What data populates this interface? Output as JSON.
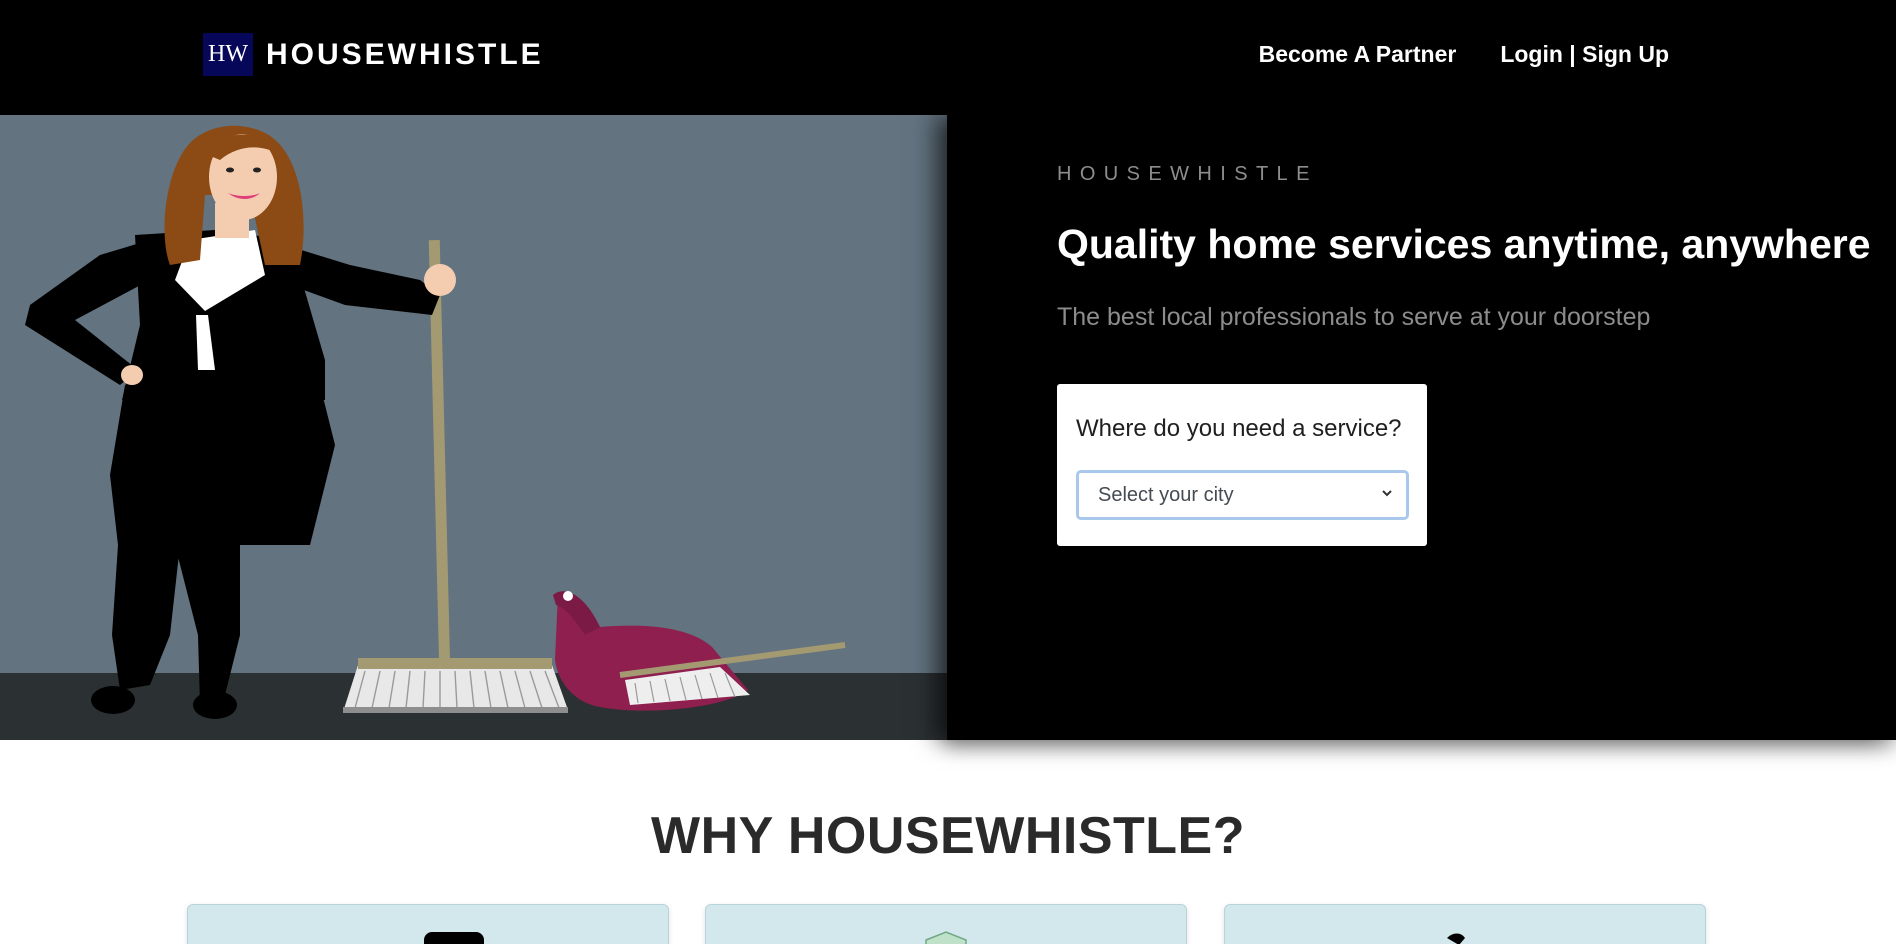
{
  "brand": {
    "logo_text": "HW",
    "name": "HOUSEWHISTLE"
  },
  "nav": {
    "partner": "Become A Partner",
    "login": "Login | Sign Up"
  },
  "hero": {
    "eyebrow": "HOUSEWHISTLE",
    "headline": "Quality home services anytime, anywhere",
    "subline": "The best local professionals to serve at your doorstep",
    "service_question": "Where do you need a service?",
    "city_select_value": "Select your city"
  },
  "why": {
    "title": "WHY HOUSEWHISTLE?"
  },
  "colors": {
    "topbar": "#000000",
    "logo_bg": "#07075a",
    "hero_wall": "#637380",
    "hero_floor": "#2b3033",
    "feature_card": "#d3e8ed"
  },
  "icons": {
    "select_chevron": "chevron-down-icon"
  }
}
